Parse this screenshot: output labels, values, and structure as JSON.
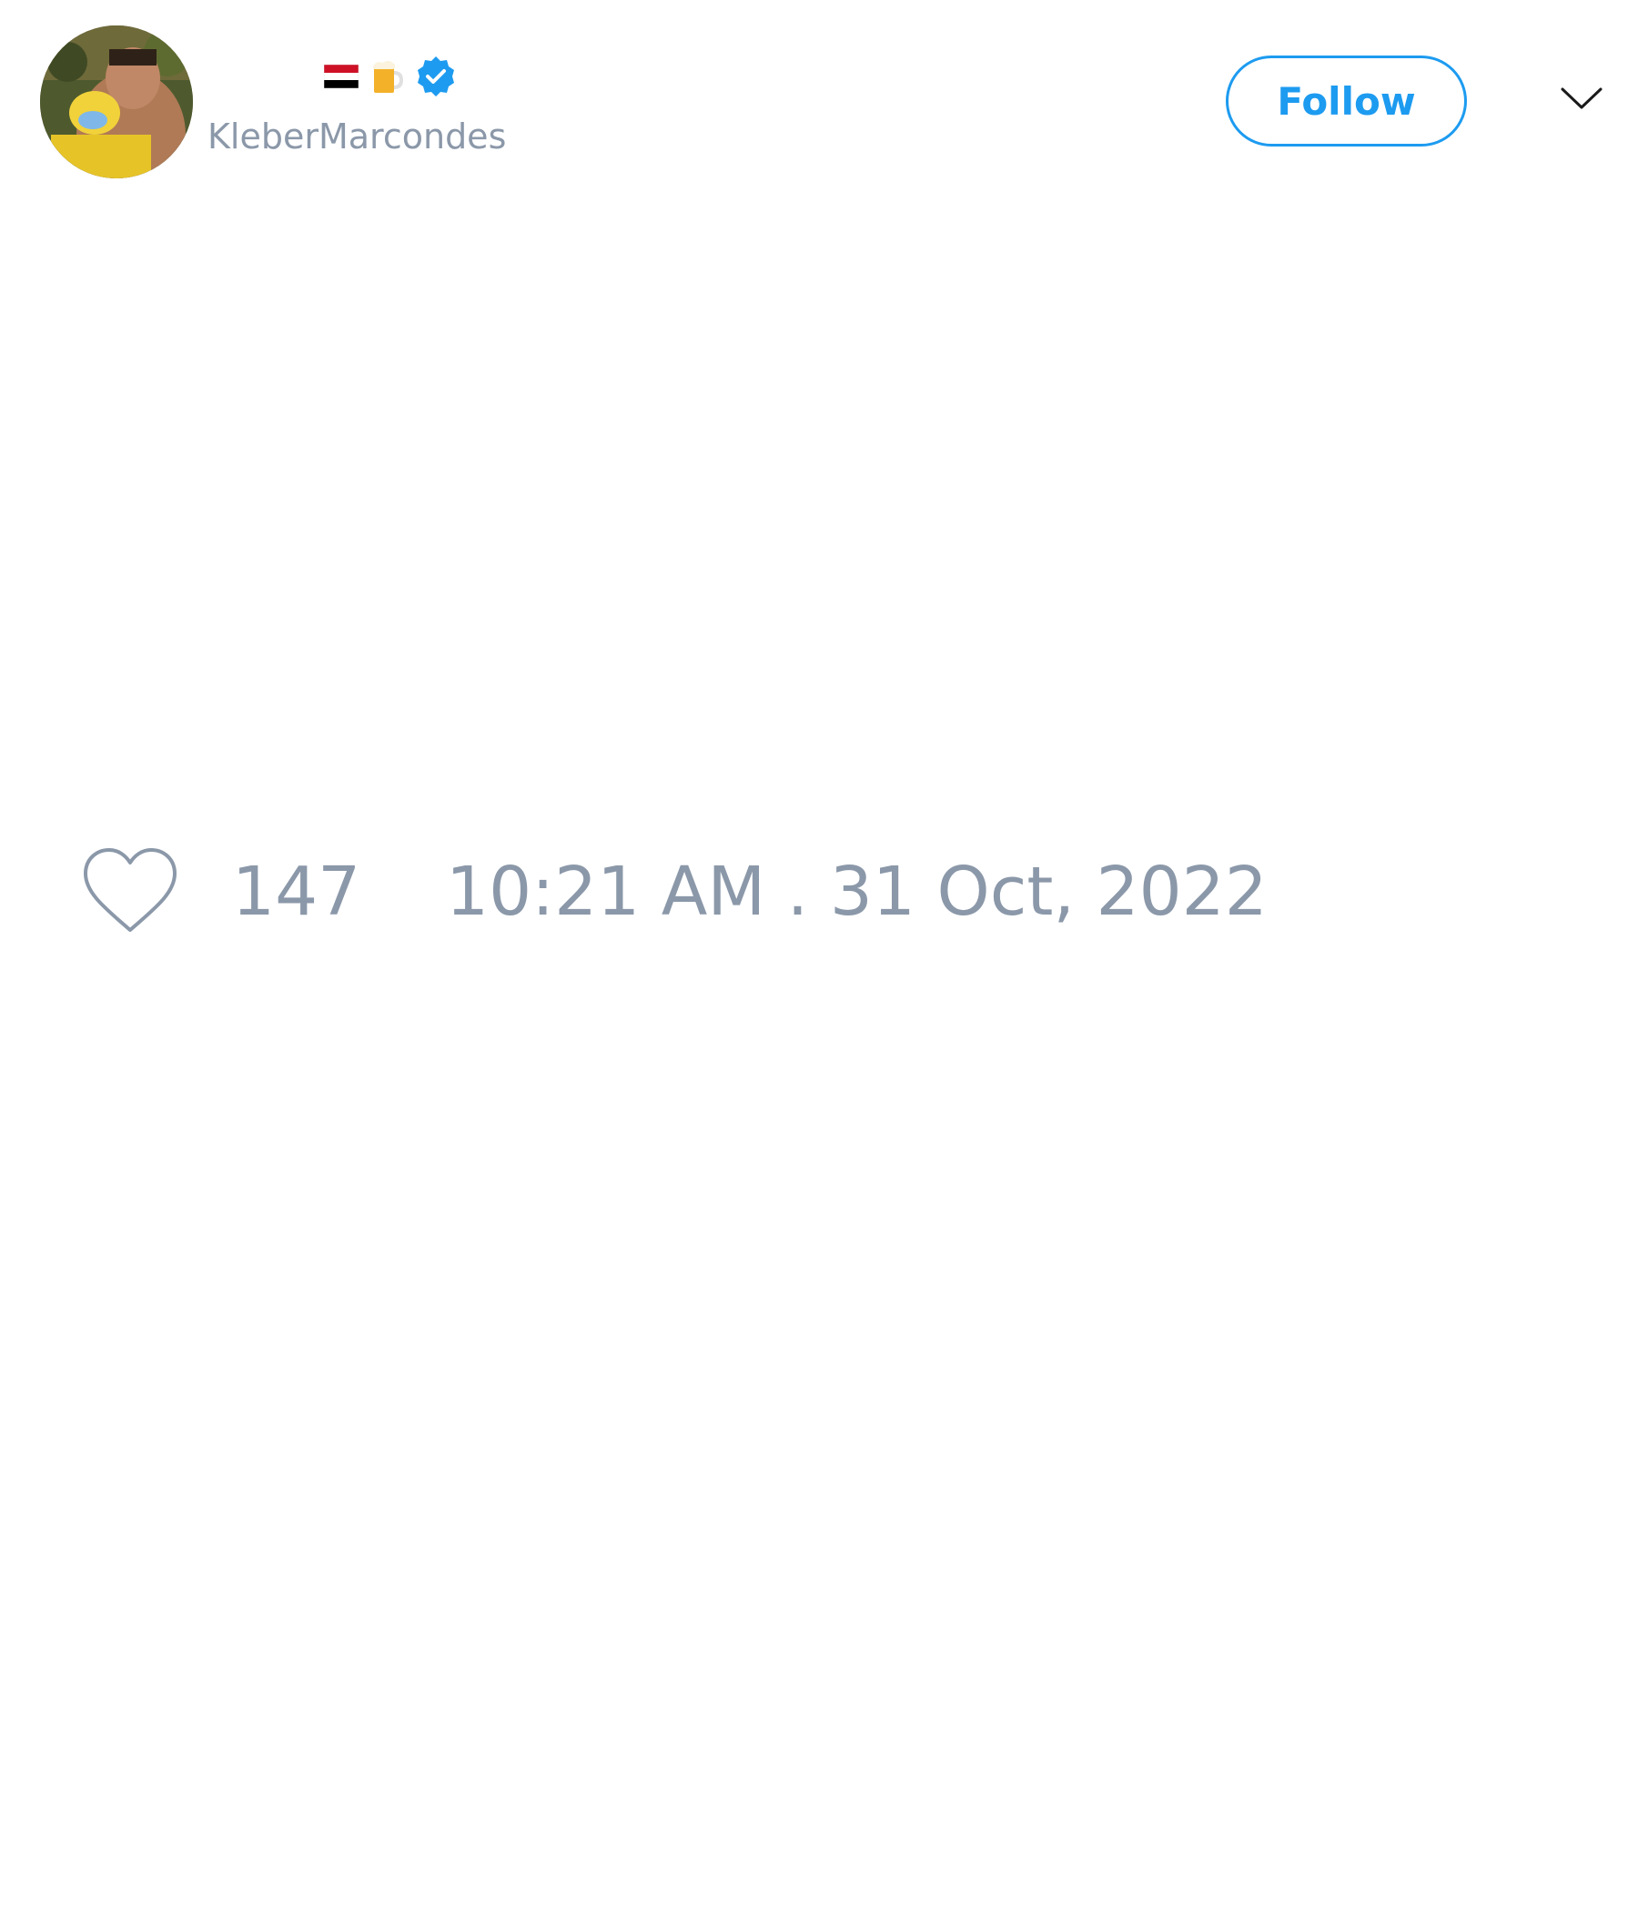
{
  "tweet": {
    "author": {
      "display_name_emojis": [
        "🇾🇪",
        "🍺"
      ],
      "verified": true,
      "handle": "KleberMarcondes",
      "avatar_icon": "profile-photo"
    },
    "follow_button_label": "Follow",
    "menu_icon": "chevron-down-icon",
    "like_icon": "heart-icon",
    "like_count": "147",
    "timestamp": "10:21 AM . 31 Oct, 2022"
  },
  "colors": {
    "accent": "#1d9bf0",
    "muted_text": "#8b98a9",
    "background": "#ffffff"
  }
}
